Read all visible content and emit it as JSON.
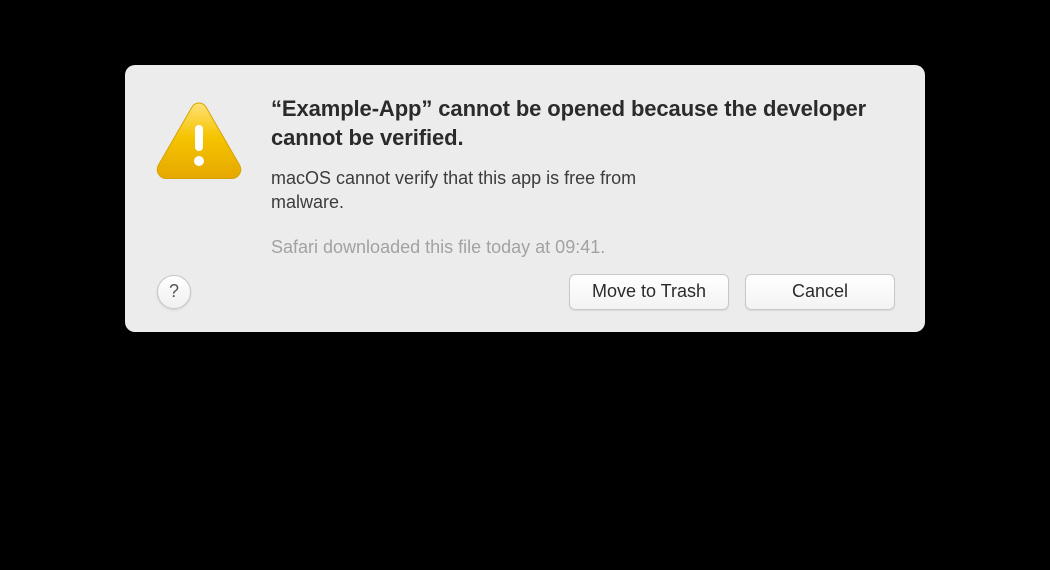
{
  "dialog": {
    "headline": "“Example-App” cannot be opened because the developer cannot be verified.",
    "subtext": "macOS cannot verify that this app is free from malware.",
    "meta": "Safari downloaded this file today at 09:41.",
    "buttons": {
      "help_label": "?",
      "move_to_trash": "Move to Trash",
      "cancel": "Cancel"
    },
    "icon": "warning-triangle",
    "colors": {
      "warning_fill": "#f2c200",
      "warning_stroke": "#d6a400"
    }
  }
}
